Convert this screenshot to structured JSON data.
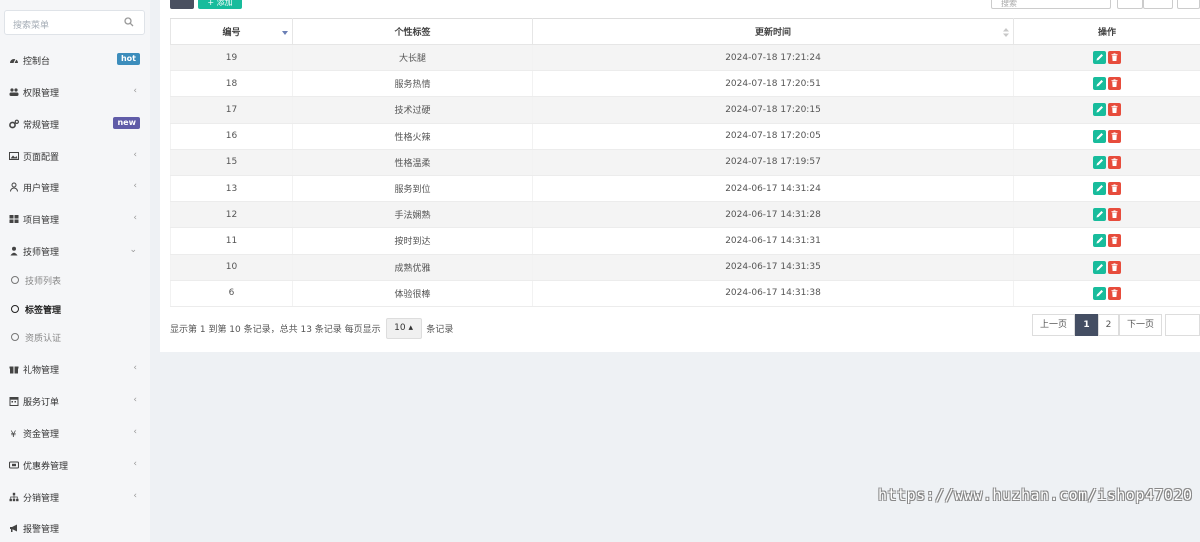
{
  "sidebar": {
    "search_placeholder": "搜索菜单",
    "items": [
      {
        "label": "控制台",
        "icon": "dashboard-icon",
        "badge": "hot",
        "badge_color": "#3c8dbc"
      },
      {
        "label": "权限管理",
        "icon": "group-icon",
        "chevron": "‹"
      },
      {
        "label": "常规管理",
        "icon": "cogs-icon",
        "badge": "new",
        "badge_color": "#605ca8"
      },
      {
        "label": "页面配置",
        "icon": "image-icon",
        "chevron": "‹"
      },
      {
        "label": "用户管理",
        "icon": "user-icon",
        "chevron": "‹"
      },
      {
        "label": "项目管理",
        "icon": "grid-icon",
        "chevron": "‹"
      },
      {
        "label": "技师管理",
        "icon": "person-icon",
        "chevron": "⌄"
      },
      {
        "label": "礼物管理",
        "icon": "gift-icon",
        "chevron": "‹"
      },
      {
        "label": "服务订单",
        "icon": "calendar-icon",
        "chevron": "‹"
      },
      {
        "label": "资金管理",
        "icon": "yen-icon",
        "chevron": "‹"
      },
      {
        "label": "优惠券管理",
        "icon": "ticket-icon",
        "chevron": "‹"
      },
      {
        "label": "分销管理",
        "icon": "sitemap-icon",
        "chevron": "‹"
      },
      {
        "label": "报警管理",
        "icon": "bullhorn-icon"
      }
    ],
    "sub_items": [
      {
        "label": "技师列表"
      },
      {
        "label": "标签管理"
      },
      {
        "label": "资质认证"
      }
    ]
  },
  "toolbar": {
    "add_label": "+ 添加",
    "search_placeholder": "搜索"
  },
  "table": {
    "columns": [
      "编号",
      "个性标签",
      "更新时间",
      "操作"
    ],
    "rows": [
      {
        "id": "19",
        "tag": "大长腿",
        "time": "2024-07-18 17:21:24"
      },
      {
        "id": "18",
        "tag": "服务热情",
        "time": "2024-07-18 17:20:51"
      },
      {
        "id": "17",
        "tag": "技术过硬",
        "time": "2024-07-18 17:20:15"
      },
      {
        "id": "16",
        "tag": "性格火辣",
        "time": "2024-07-18 17:20:05"
      },
      {
        "id": "15",
        "tag": "性格温柔",
        "time": "2024-07-18 17:19:57"
      },
      {
        "id": "13",
        "tag": "服务到位",
        "time": "2024-06-17 14:31:24"
      },
      {
        "id": "12",
        "tag": "手法娴熟",
        "time": "2024-06-17 14:31:28"
      },
      {
        "id": "11",
        "tag": "按时到达",
        "time": "2024-06-17 14:31:31"
      },
      {
        "id": "10",
        "tag": "成熟优雅",
        "time": "2024-06-17 14:31:35"
      },
      {
        "id": "6",
        "tag": "体验很棒",
        "time": "2024-06-17 14:31:38"
      }
    ]
  },
  "pagination": {
    "info": "显示第 1 到第 10 条记录，总共 13 条记录 每页显示",
    "page_size": "10 ▴",
    "suffix": "条记录",
    "prev": "上一页",
    "pages": [
      "1",
      "2"
    ],
    "next": "下一页"
  },
  "watermark": "https://www.huzhan.com/ishop47020"
}
